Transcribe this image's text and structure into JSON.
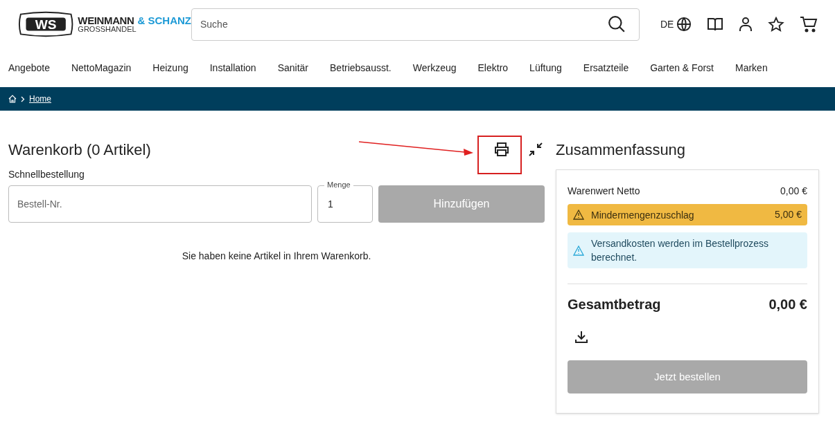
{
  "logo": {
    "mark": "WS",
    "name": "WEINMANN",
    "name_accent": "& SCHANZ",
    "tagline": "GROSSHANDEL"
  },
  "search": {
    "placeholder": "Suche"
  },
  "language": "DE",
  "nav": [
    "Angebote",
    "NettoMagazin",
    "Heizung",
    "Installation",
    "Sanitär",
    "Betriebsausst.",
    "Werkzeug",
    "Elektro",
    "Lüftung",
    "Ersatzteile",
    "Garten & Forst",
    "Marken"
  ],
  "breadcrumb": [
    "Home"
  ],
  "cart": {
    "title": "Warenkorb (0 Artikel)",
    "quick_order_label": "Schnellbestellung",
    "order_number_placeholder": "Bestell-Nr.",
    "quantity_label": "Menge",
    "quantity": "1",
    "add_button": {
      "label": "Hinzufügen",
      "disabled": true
    },
    "empty_message": "Sie haben keine Artikel in Ihrem Warenkorb."
  },
  "summary": {
    "title": "Zusammenfassung",
    "net_label": "Warenwert Netto",
    "net_value": "0,00 €",
    "notices": [
      {
        "kind": "warning",
        "text": "Mindermengenzuschlag",
        "value": "5,00 €"
      },
      {
        "kind": "info",
        "text": "Versandkosten werden im Bestellprozess berechnet."
      }
    ],
    "total_label": "Gesamtbetrag",
    "total_value": "0,00 €",
    "order_button": {
      "label": "Jetzt bestellen",
      "disabled": true
    }
  }
}
